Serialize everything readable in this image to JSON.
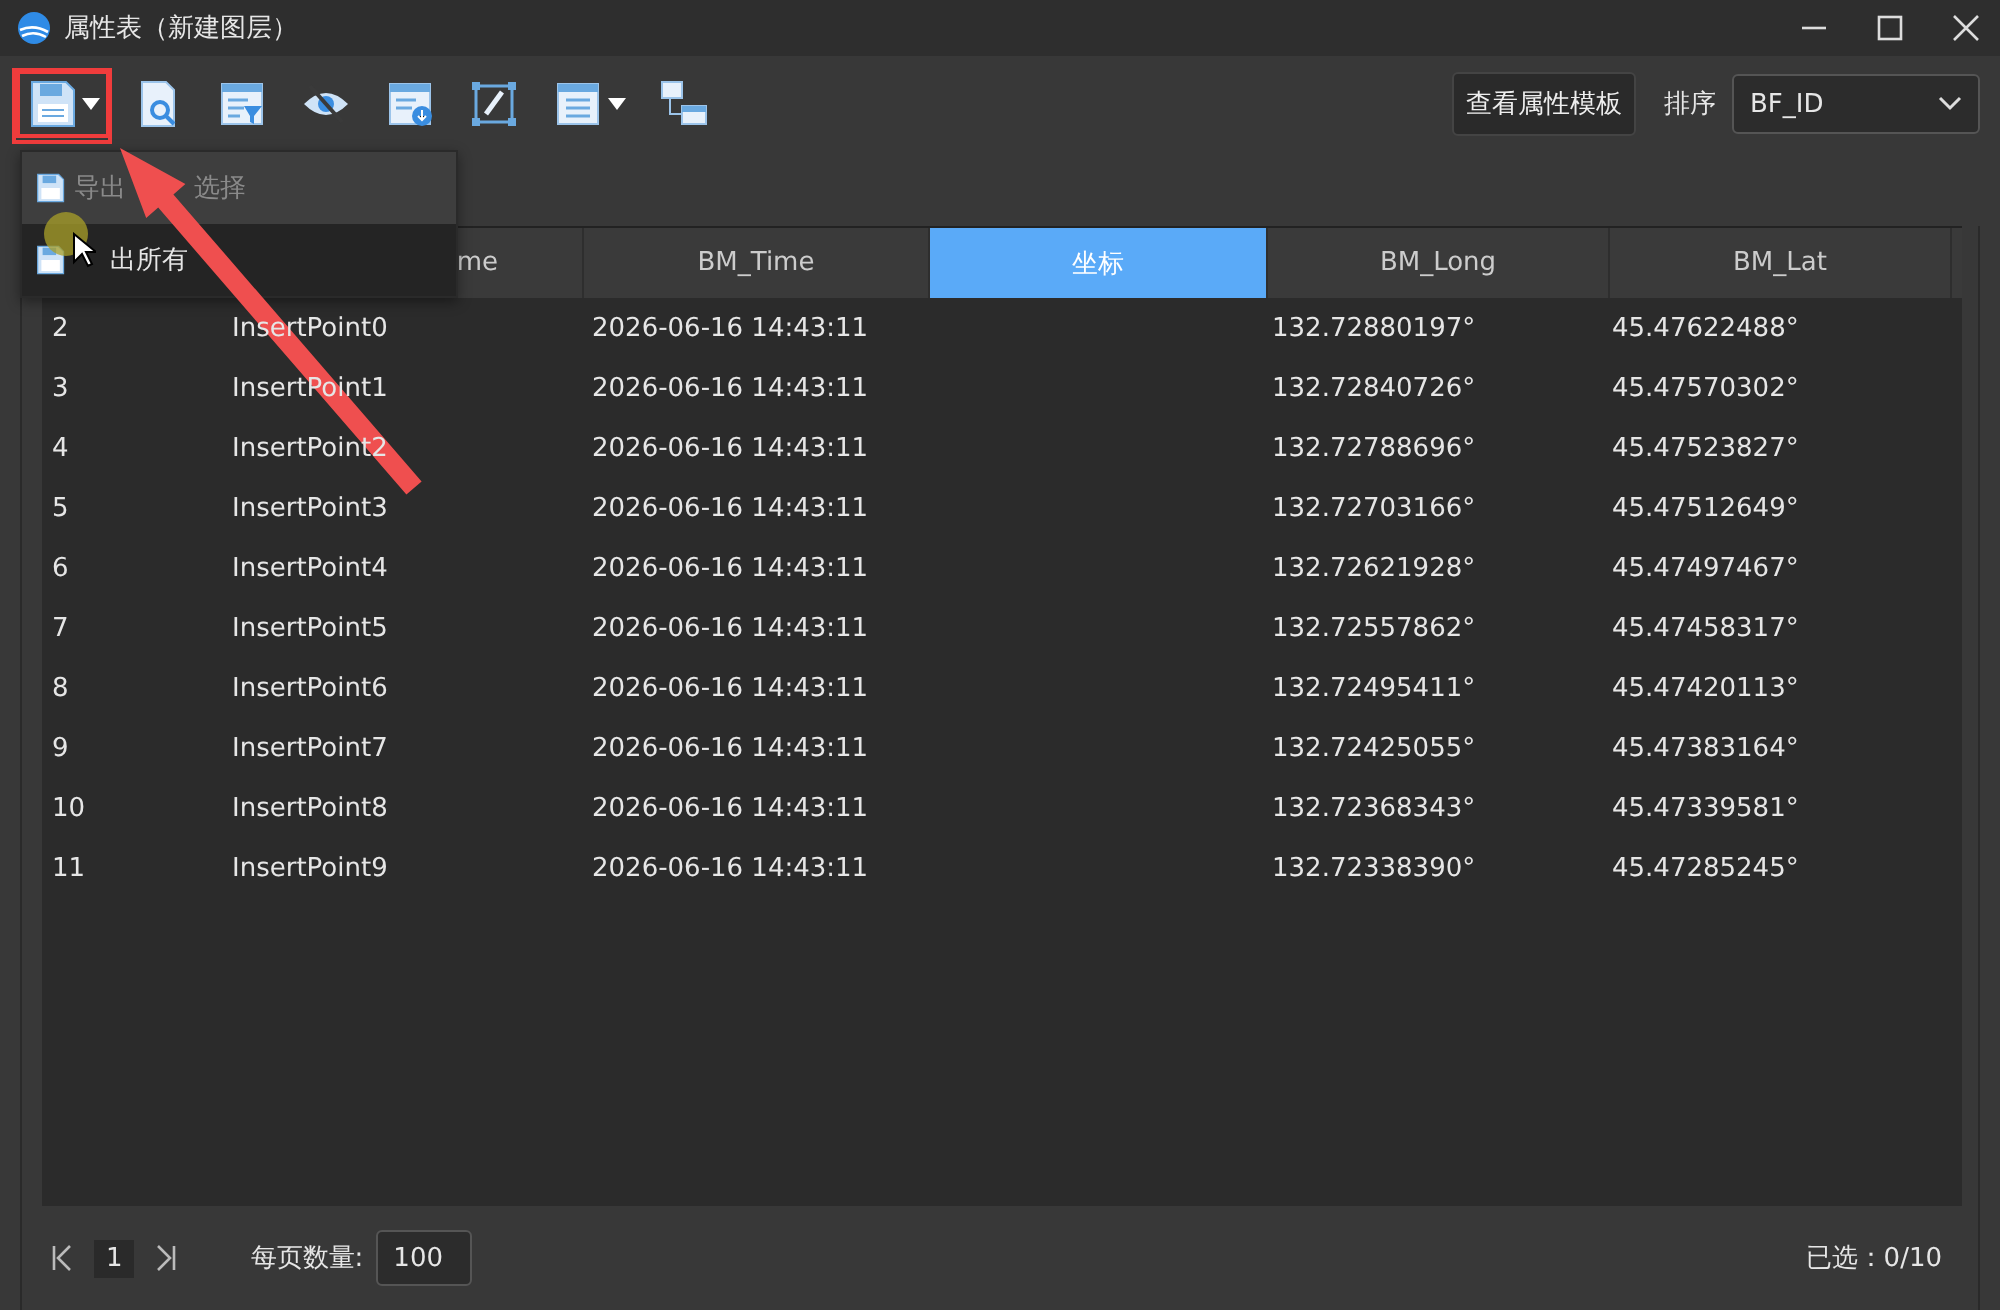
{
  "window": {
    "title": "属性表（新建图层）"
  },
  "toolbar": {
    "tools": [
      {
        "kind": "save",
        "dropdown": true,
        "highlighted": true
      },
      {
        "kind": "find",
        "dropdown": false,
        "highlighted": false
      },
      {
        "kind": "filter",
        "dropdown": false,
        "highlighted": false
      },
      {
        "kind": "hide",
        "dropdown": false,
        "highlighted": false
      },
      {
        "kind": "import",
        "dropdown": false,
        "highlighted": false
      },
      {
        "kind": "edit",
        "dropdown": false,
        "highlighted": false
      },
      {
        "kind": "list",
        "dropdown": true,
        "highlighted": false
      },
      {
        "kind": "link",
        "dropdown": false,
        "highlighted": false
      }
    ],
    "template_button": "查看属性模板",
    "sort_label": "排序",
    "sort_value": "BF_ID"
  },
  "export_menu": {
    "items": [
      {
        "parts": [
          "导出",
          "选择"
        ],
        "disabled": true,
        "hovered": false
      },
      {
        "parts": [
          "出所有"
        ],
        "disabled": false,
        "hovered": true
      }
    ]
  },
  "table": {
    "columns": [
      {
        "label": "me",
        "selected": false
      },
      {
        "label": "BM_Time",
        "selected": false
      },
      {
        "label": "坐标",
        "selected": true
      },
      {
        "label": "BM_Long",
        "selected": false
      },
      {
        "label": "BM_Lat",
        "selected": false
      }
    ],
    "rows": [
      {
        "id": "2",
        "name": "InsertPoint0",
        "time": "2026-06-16 14:43:11",
        "long": "132.72880197°",
        "lat": "45.47622488°"
      },
      {
        "id": "3",
        "name": "InsertPoint1",
        "time": "2026-06-16 14:43:11",
        "long": "132.72840726°",
        "lat": "45.47570302°"
      },
      {
        "id": "4",
        "name": "InsertPoint2",
        "time": "2026-06-16 14:43:11",
        "long": "132.72788696°",
        "lat": "45.47523827°"
      },
      {
        "id": "5",
        "name": "InsertPoint3",
        "time": "2026-06-16 14:43:11",
        "long": "132.72703166°",
        "lat": "45.47512649°"
      },
      {
        "id": "6",
        "name": "InsertPoint4",
        "time": "2026-06-16 14:43:11",
        "long": "132.72621928°",
        "lat": "45.47497467°"
      },
      {
        "id": "7",
        "name": "InsertPoint5",
        "time": "2026-06-16 14:43:11",
        "long": "132.72557862°",
        "lat": "45.47458317°"
      },
      {
        "id": "8",
        "name": "InsertPoint6",
        "time": "2026-06-16 14:43:11",
        "long": "132.72495411°",
        "lat": "45.47420113°"
      },
      {
        "id": "9",
        "name": "InsertPoint7",
        "time": "2026-06-16 14:43:11",
        "long": "132.72425055°",
        "lat": "45.47383164°"
      },
      {
        "id": "10",
        "name": "InsertPoint8",
        "time": "2026-06-16 14:43:11",
        "long": "132.72368343°",
        "lat": "45.47339581°"
      },
      {
        "id": "11",
        "name": "InsertPoint9",
        "time": "2026-06-16 14:43:11",
        "long": "132.72338390°",
        "lat": "45.47285245°"
      }
    ]
  },
  "pager": {
    "page": "1",
    "per_page_label": "每页数量:",
    "per_page": "100",
    "selected": "已选：0/10"
  }
}
